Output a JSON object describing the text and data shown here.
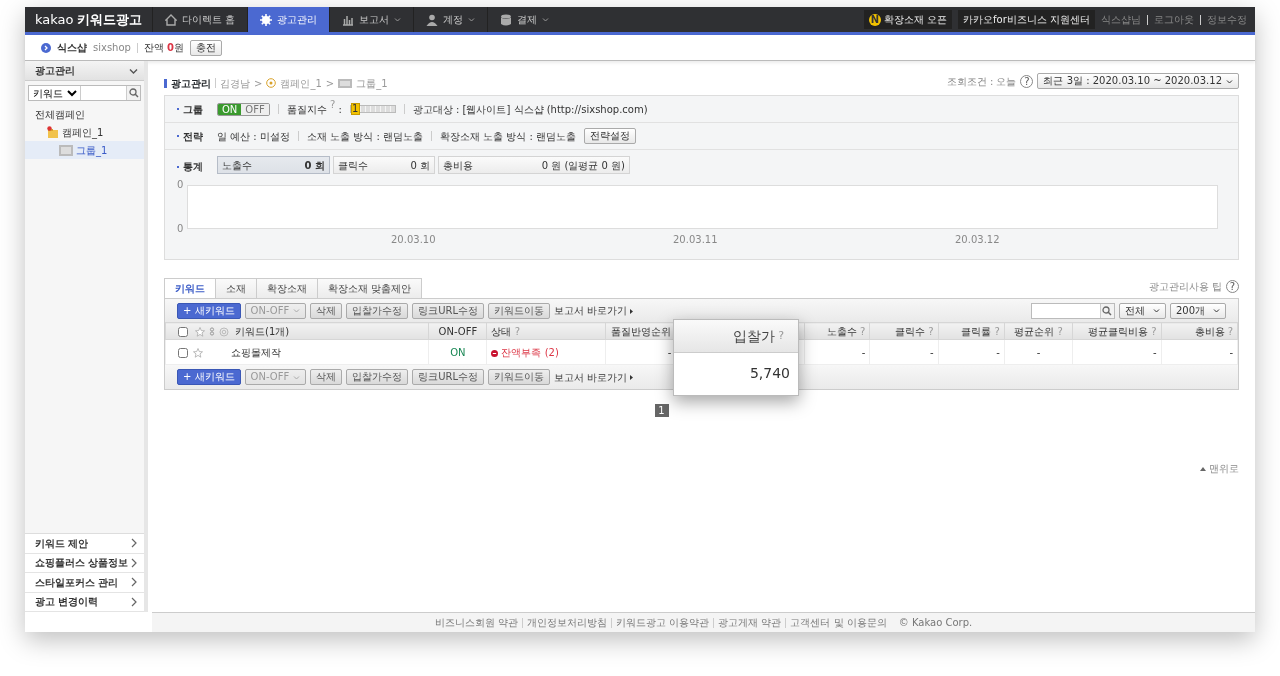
{
  "topnav": {
    "logo_en": "kakao",
    "logo_ko": "키워드광고",
    "items": [
      {
        "label": "다이렉트 홈",
        "dropdown": false,
        "selected": false
      },
      {
        "label": "광고관리",
        "dropdown": false,
        "selected": true
      },
      {
        "label": "보고서",
        "dropdown": true,
        "selected": false
      },
      {
        "label": "계정",
        "dropdown": true,
        "selected": false
      },
      {
        "label": "결제",
        "dropdown": true,
        "selected": false
      }
    ],
    "new_badge": "N",
    "promo": "확장소재 오픈",
    "support": "카카오for비즈니스 지원센터",
    "links": [
      "식스샵님",
      "로그아웃",
      "정보수정"
    ]
  },
  "account": {
    "name": "식스샵",
    "id": "sixshop",
    "balance_label": "잔액",
    "balance_value": "0",
    "balance_unit": "원",
    "charge_button": "충전"
  },
  "sidebar": {
    "title": "광고관리",
    "search_type": "키워드",
    "tree": [
      {
        "label": "전체캠페인",
        "selected": false,
        "children": [
          {
            "label": "캠페인_1",
            "selected": false,
            "children": [
              {
                "label": "그룹_1",
                "selected": true
              }
            ]
          }
        ]
      }
    ],
    "menu": [
      "키워드 제안",
      "쇼핑플러스 상품정보",
      "스타일포커스 관리",
      "광고 변경이력"
    ]
  },
  "breadcrumb": {
    "root": "광고관리",
    "items": [
      "김경남",
      "캠페인_1",
      "그룹_1"
    ],
    "separator": ">"
  },
  "period": {
    "label": "조회조건 : 오늘",
    "help": "?",
    "value": "최근 3일 : 2020.03.10 ~ 2020.03.12"
  },
  "group_panel": {
    "group_label": "그룹",
    "on": true,
    "on_text": "ON",
    "off_text": "OFF",
    "quality_label": "품질지수",
    "quality_help": "?",
    "quality_colon": ":",
    "quality_value": "1",
    "quality_meter": {
      "level": 0.1
    },
    "target": "광고대상 : [웹사이트] 식스샵 (http://sixshop.com)",
    "strategy_label": "전략",
    "strategy_items": [
      "일 예산 : 미설정",
      "소재 노출 방식 : 랜덤노출",
      "확장소재 노출 방식 : 랜덤노출"
    ],
    "strategy_button": "전략설정",
    "stats_label": "통계",
    "stats": [
      {
        "label": "노출수",
        "value": "0 회",
        "selected": true
      },
      {
        "label": "클릭수",
        "value": "0 회",
        "selected": false
      },
      {
        "label": "총비용",
        "value": "0 원 (일평균 0 원)",
        "selected": false
      }
    ],
    "chart": {
      "y_labels": [
        "0",
        "0"
      ],
      "x_labels": [
        "20.03.10",
        "20.03.11",
        "20.03.12"
      ]
    }
  },
  "tip": {
    "label": "광고관리사용 팁",
    "help": "?"
  },
  "tabs": [
    {
      "label": "키워드",
      "selected": true
    },
    {
      "label": "소재",
      "selected": false
    },
    {
      "label": "확장소재",
      "selected": false
    },
    {
      "label": "확장소재 맞춤제안",
      "selected": false
    }
  ],
  "toolbars": [
    {
      "buttons": [
        {
          "label": "+ 새키워드",
          "kind": "primary",
          "disabled": false
        },
        {
          "label": "ON-OFF",
          "kind": "split",
          "disabled": true
        },
        {
          "label": "삭제",
          "kind": "plain",
          "disabled": false
        },
        {
          "label": "입찰가수정",
          "kind": "plain",
          "disabled": false
        },
        {
          "label": "링크URL수정",
          "kind": "plain",
          "disabled": false
        },
        {
          "label": "키워드이동",
          "kind": "plain",
          "disabled": false
        }
      ],
      "report_link": "보고서 바로가기",
      "filters": true
    },
    {
      "buttons": [
        {
          "label": "+ 새키워드",
          "kind": "primary",
          "disabled": false
        },
        {
          "label": "ON-OFF",
          "kind": "split",
          "disabled": true
        },
        {
          "label": "삭제",
          "kind": "plain",
          "disabled": false
        },
        {
          "label": "입찰가수정",
          "kind": "plain",
          "disabled": false
        },
        {
          "label": "링크URL수정",
          "kind": "plain",
          "disabled": false
        },
        {
          "label": "키워드이동",
          "kind": "plain",
          "disabled": false
        }
      ],
      "report_link": "보고서 바로가기",
      "filters": false
    }
  ],
  "filters": {
    "status": "전체",
    "page_size": "200개"
  },
  "table": {
    "select_all_checked": false,
    "columns": [
      {
        "label": "키워드(1개)"
      },
      {
        "label": "ON-OFF"
      },
      {
        "label": "상태",
        "help": "?"
      },
      {
        "label": "품질반영순위"
      },
      {
        "label": "노출수",
        "help": "?"
      },
      {
        "label": "클릭수",
        "help": "?"
      },
      {
        "label": "클릭률",
        "help": "?"
      },
      {
        "label": "평균순위",
        "help": "?"
      },
      {
        "label": "평균클릭비용",
        "help": "?"
      },
      {
        "label": "총비용",
        "help": "?"
      }
    ],
    "rows": [
      {
        "checked": false,
        "starred": false,
        "cells": [
          "쇼핑몰제작",
          "ON",
          "잔액부족 (2)",
          "-",
          "-",
          "-",
          "-",
          "-",
          "-",
          "-"
        ]
      }
    ]
  },
  "zoom_popup": {
    "header": "입찰가",
    "help": "?",
    "value": "5,740"
  },
  "pagination": [
    {
      "label": "1",
      "selected": true
    }
  ],
  "to_top": "맨위로",
  "footer": {
    "links": [
      "비즈니스회원 약관",
      "개인정보처리방침",
      "키워드광고 이용약관",
      "광고게재 약관",
      "고객센터 및 이용문의"
    ],
    "copyright": "© Kakao Corp."
  }
}
